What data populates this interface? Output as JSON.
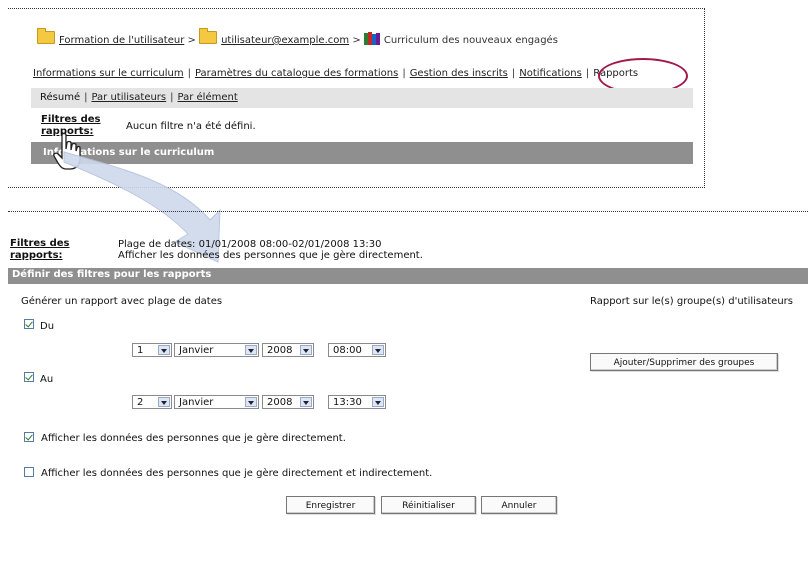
{
  "breadcrumb": {
    "item1": "Formation de l'utilisateur",
    "sep": ">",
    "item2": "utilisateur@example.com",
    "item3": "Curriculum des nouveaux engagés"
  },
  "tabs": [
    {
      "label": "Informations sur le curriculum"
    },
    {
      "label": "Paramètres du catalogue des formations"
    },
    {
      "label": "Gestion des inscrits"
    },
    {
      "label": "Notifications"
    },
    {
      "label": "Rapports"
    }
  ],
  "subnav": {
    "summary": "Résumé",
    "by_users": "Par utilisateurs",
    "by_element": "Par élément"
  },
  "top_filters": {
    "label": "Filtres des rapports:",
    "value": "Aucun filtre n'a été défini.",
    "bar_text": "Informations sur le curriculum"
  },
  "filters": {
    "label_line1": "Filtres des",
    "label_line2": "rapports:",
    "line1": "Plage de dates: 01/01/2008 08:00-02/01/2008 13:30",
    "line2": "Afficher les données des personnes que je gère directement."
  },
  "define_bar": "Définir des filtres pour les rapports",
  "date_range_title": "Générer un rapport avec plage de dates",
  "group_title": "Rapport sur le(s) groupe(s) d'utilisateurs",
  "from": {
    "label": "Du",
    "checked": true,
    "day": "1",
    "month": "Janvier",
    "year": "2008",
    "time": "08:00"
  },
  "to": {
    "label": "Au",
    "checked": true,
    "day": "2",
    "month": "Janvier",
    "year": "2008",
    "time": "13:30"
  },
  "groups_button": "Ajouter/Supprimer des groupes",
  "option_direct": {
    "label": "Afficher les données des personnes que je gère directement.",
    "checked": true
  },
  "option_indirect": {
    "label": "Afficher les données des personnes que je gère directement et indirectement.",
    "checked": false
  },
  "buttons": {
    "save": "Enregistrer",
    "reset": "Réinitialiser",
    "cancel": "Annuler"
  },
  "colors": {
    "highlight_circle": "#a0194a",
    "dark_bar": "#8f8f8f",
    "gray_bar": "#e4e4e4",
    "arrow": "#cfd9ec"
  }
}
